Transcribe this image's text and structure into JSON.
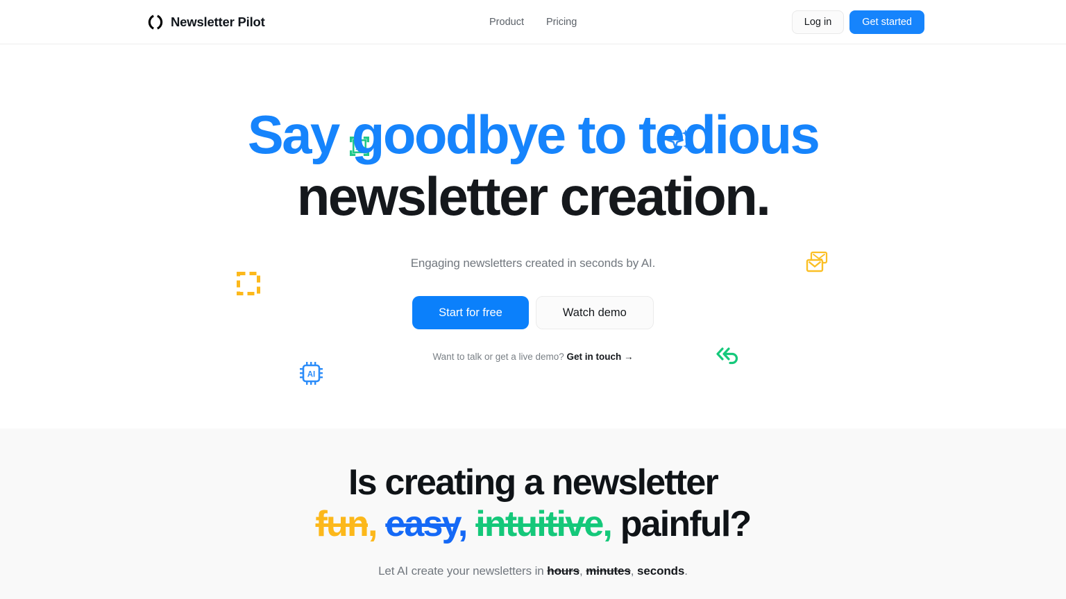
{
  "header": {
    "brand": {
      "name": "Newsletter Pilot",
      "logo_icon": "circle-brackets-logo-icon"
    },
    "nav": [
      {
        "label": "Product",
        "name": "nav-link-product"
      },
      {
        "label": "Pricing",
        "name": "nav-link-pricing"
      }
    ],
    "login_label": "Log in",
    "get_started_label": "Get started"
  },
  "hero": {
    "title_line1_accent": "Say goodbye to tedious",
    "title_line2": "newsletter creation.",
    "subtitle": "Engaging newsletters created in seconds by AI.",
    "primary_cta": "Start for free",
    "secondary_cta": "Watch demo",
    "note_prefix": "Want to talk or get a live demo?",
    "note_link": "Get in touch →",
    "decorations": [
      {
        "name": "image-placeholder-icon",
        "color": "#22c98a"
      },
      {
        "name": "sparkles-icon",
        "color": "#2b8cf9"
      },
      {
        "name": "dashed-square-icon",
        "color": "#fcb81b"
      },
      {
        "name": "stacked-mail-icon",
        "color": "#fbbf24"
      },
      {
        "name": "ai-chip-icon",
        "color": "#2b8cf9"
      },
      {
        "name": "reply-all-icon",
        "color": "#16c87b"
      }
    ]
  },
  "section2": {
    "title_line1": "Is creating a newsletter",
    "word_fun": "fun",
    "word_easy": "easy",
    "word_intuitive": "intuitive",
    "word_painful": "painful?",
    "comma": ",",
    "sub_prefix": "Let AI create your newsletters in",
    "sub_hours": "hours",
    "sub_minutes": "minutes",
    "sub_seconds": "seconds",
    "sub_period": "."
  },
  "colors": {
    "brand_blue": "#1684fc",
    "accent_amber": "#fcb81b",
    "accent_green": "#15c87a",
    "text_dark": "#15181c",
    "text_muted": "#71777e",
    "section_bg": "#f9f9f9"
  }
}
